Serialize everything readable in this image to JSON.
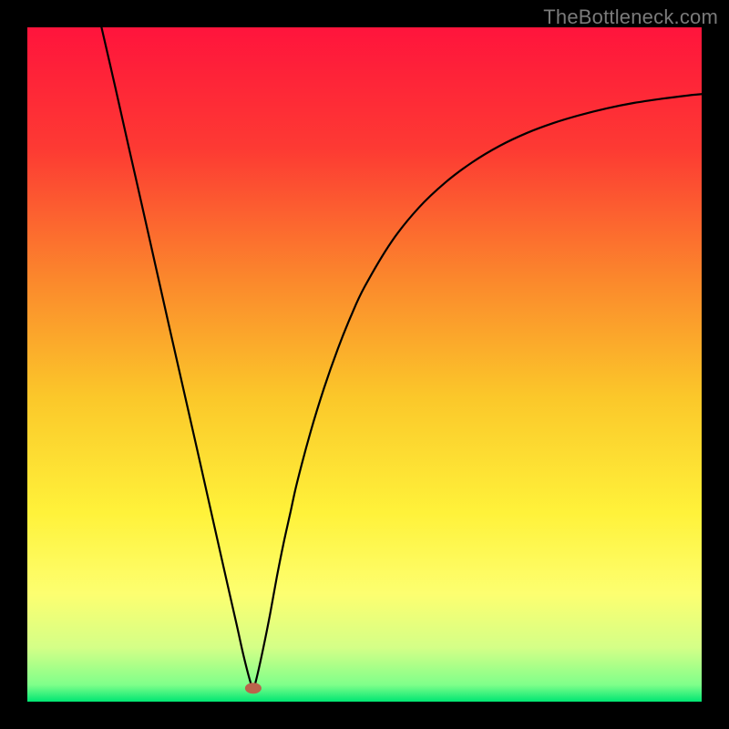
{
  "watermark": "TheBottleneck.com",
  "chart_data": {
    "type": "line",
    "title": "",
    "xlabel": "",
    "ylabel": "",
    "xlim": [
      0,
      100
    ],
    "ylim": [
      0,
      100
    ],
    "gradient_stops": [
      {
        "offset": 0.0,
        "color": "#ff143c"
      },
      {
        "offset": 0.18,
        "color": "#fd3a33"
      },
      {
        "offset": 0.38,
        "color": "#fb8a2c"
      },
      {
        "offset": 0.55,
        "color": "#fbc82a"
      },
      {
        "offset": 0.72,
        "color": "#fff23a"
      },
      {
        "offset": 0.84,
        "color": "#fdff70"
      },
      {
        "offset": 0.92,
        "color": "#d4ff87"
      },
      {
        "offset": 0.975,
        "color": "#7fff8a"
      },
      {
        "offset": 1.0,
        "color": "#00e673"
      }
    ],
    "marker": {
      "x": 33.5,
      "y": 2.0,
      "color": "#bb634b"
    },
    "series": [
      {
        "name": "curve",
        "color": "#000000",
        "x": [
          11.0,
          13.0,
          15.0,
          17.0,
          19.0,
          21.0,
          23.0,
          25.0,
          27.0,
          29.0,
          31.0,
          32.0,
          33.0,
          33.5,
          34.0,
          35.0,
          36.0,
          37.0,
          38.0,
          39.0,
          40.0,
          42.0,
          44.0,
          46.0,
          48.0,
          50.0,
          54.0,
          58.0,
          62.0,
          66.0,
          70.0,
          74.0,
          78.0,
          82.0,
          86.0,
          90.0,
          94.0,
          98.0,
          100.0
        ],
        "values": [
          100.0,
          91.3,
          82.4,
          73.6,
          64.7,
          55.8,
          47.0,
          38.2,
          29.3,
          20.4,
          11.6,
          7.1,
          3.2,
          2.0,
          3.5,
          8.0,
          13.0,
          18.5,
          23.5,
          28.0,
          32.5,
          40.0,
          46.5,
          52.2,
          57.2,
          61.5,
          68.2,
          73.2,
          77.0,
          80.0,
          82.4,
          84.3,
          85.8,
          87.0,
          88.0,
          88.8,
          89.4,
          89.9,
          90.1
        ]
      }
    ]
  }
}
